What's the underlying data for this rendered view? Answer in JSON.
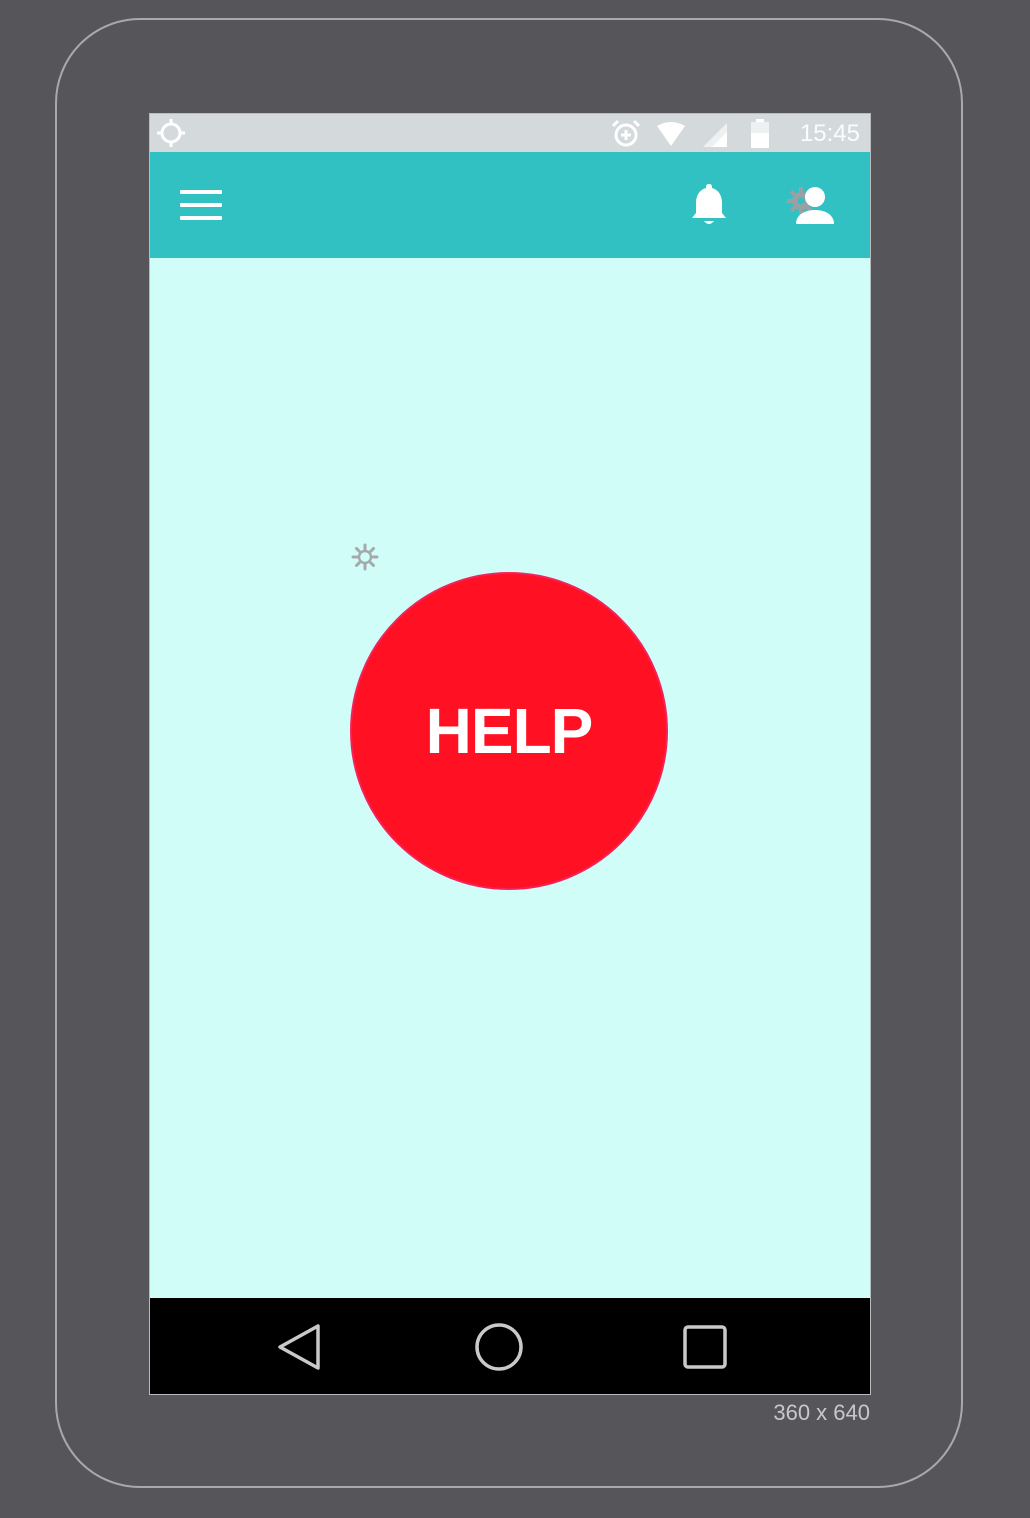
{
  "status_bar": {
    "time": "15:45",
    "icons": [
      "target-icon",
      "alarm-icon",
      "wifi-icon",
      "signal-icon",
      "battery-icon"
    ]
  },
  "app_bar": {
    "background": "#31c1c2",
    "icons": [
      "menu-icon",
      "bell-icon",
      "account-icon",
      "gear-icon"
    ]
  },
  "main": {
    "background": "#d1fdf8",
    "help_button": {
      "label": "HELP",
      "color": "#ff1022"
    }
  },
  "nav_bar": {
    "icons": [
      "back-icon",
      "home-icon",
      "recent-apps-icon"
    ]
  },
  "device": {
    "dimensions_label": "360 x 640"
  }
}
